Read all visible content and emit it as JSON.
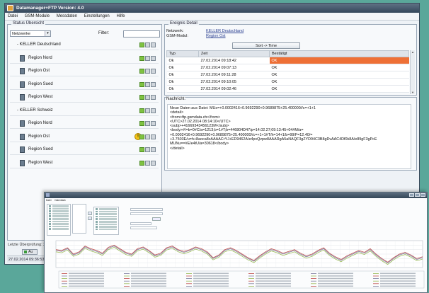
{
  "win1": {
    "title": "Datamanager+FTP Version: 4.0",
    "menu": [
      "Datei",
      "GSM-Module",
      "Messdaten",
      "Einstellungen",
      "Hilfe"
    ],
    "left": {
      "group_title": "Status Übersicht",
      "combo_value": "Netzwerke",
      "filter_label": "Filter:",
      "rows": [
        {
          "label": "- KELLER Deutschland",
          "level": 0,
          "lights": [
            "g",
            "n",
            "n"
          ]
        },
        {
          "label": "Region Nord",
          "level": 1,
          "lights": [
            "g",
            "n",
            "n"
          ]
        },
        {
          "label": "Region Ost",
          "level": 1,
          "lights": [
            "g",
            "n",
            "n"
          ]
        },
        {
          "label": "Region Sued",
          "level": 1,
          "lights": [
            "g",
            "n",
            "n"
          ]
        },
        {
          "label": "Region West",
          "level": 1,
          "lights": [
            "g",
            "n",
            "n"
          ]
        },
        {
          "label": "- KELLER Schweiz",
          "level": 0,
          "lights": [
            "g",
            "n",
            "n"
          ]
        },
        {
          "label": "Region Nord",
          "level": 1,
          "lights": [
            "g",
            "n",
            "n"
          ]
        },
        {
          "label": "Region Ost",
          "level": 1,
          "lights": [
            "g",
            "n",
            "n"
          ],
          "warning": true
        },
        {
          "label": "Region Sued",
          "level": 1,
          "lights": [
            "g",
            "n",
            "n"
          ]
        },
        {
          "label": "Region West",
          "level": 1,
          "lights": [
            "g",
            "n",
            "n"
          ]
        }
      ],
      "last_check": "Letzte Überprüfung: 27.0",
      "datetime": "27.02.2014 09:36:53",
      "au_button": "Au"
    },
    "detail": {
      "group_title": "Ereignis Detail",
      "netzwerk_label": "Netzwerk:",
      "netzwerk_value": "KELLER Deutschland",
      "modul_label": "GSM-Modul:",
      "modul_value": "Region Ost",
      "sort_button": "Sort -> Time",
      "columns": [
        "Typ",
        "Zeit",
        "Bestätigt"
      ],
      "rows": [
        [
          "Ok",
          "27.02.2014 09:18:42",
          "OK"
        ],
        [
          "Ok",
          "27.02.2014 09:07:13",
          "OK"
        ],
        [
          "Ok",
          "27.02.2014 09:11:28",
          "OK"
        ],
        [
          "Ok",
          "27.02.2014 09:10:05",
          "OK"
        ],
        [
          "Ok",
          "27.02.2014 09:02:46",
          "OK"
        ]
      ],
      "note_label": "Nachricht:",
      "note_text": "Neue Daten aus Datei: MUs=+0.0002416+0.9692290+0.9689875+25.400000//c=+1+1\n<detail>\n<from>ftp.gsmdata.ch</from>\n<UTC>27.02.2014 08:14:10</UTC>\n<subj>+41669343456123M</subj>\n<body>#/=b=0#C/a=1213;b=1#T;b=446804D47/p=14.02.27;09:13:45+04#M/a=\n+0.0002416+0.9692290+0.9689875+25.400000//c=+1+1#T/h=14+1/b=99/F=12.40/=\n+3.7503E/u=h+8aoca8cAAAACrYJ+ED9462A/e4pvQzpw8AAARgA5aNAQF3gZYD94C3B8gDvAAC4Df0k8A/e89gF3gPcE\nMUNu==#E/e4tU/a=30618</body>\n</detail>"
    }
  },
  "win2": {
    "menu": [
      "Datei",
      "Datenbank"
    ],
    "chart_data": {
      "type": "line",
      "title": "",
      "xlabel": "",
      "ylabel": "",
      "series": [
        {
          "values": [
            1.2,
            1.18,
            1.24,
            1.1,
            1.15,
            1.28,
            1.22,
            1.18,
            1.12,
            1.25,
            1.3,
            1.22,
            1.14,
            1.1,
            1.22,
            1.26,
            1.18,
            1.08,
            1.12,
            1.24,
            1.28,
            1.2,
            1.16,
            1.2,
            1.26,
            1.22,
            1.15,
            1.02,
            1.08,
            1.2,
            1.24,
            1.18,
            1.1,
            1.02,
            0.96,
            1.06,
            1.15,
            1.22,
            1.18,
            1.12,
            1.16,
            1.2,
            1.12,
            1.06,
            1.1,
            1.18,
            1.24,
            1.12,
            1.04,
            0.98,
            1.06,
            1.12,
            1.18,
            1.14,
            1.22,
            1.1,
            1.0,
            0.92,
            1.02,
            1.1,
            1.14,
            1.08,
            1.0,
            1.04
          ]
        },
        {
          "values": [
            1.18,
            1.16,
            1.22,
            1.08,
            1.13,
            1.26,
            1.2,
            1.16,
            1.1,
            1.23,
            1.28,
            1.2,
            1.12,
            1.08,
            1.2,
            1.24,
            1.16,
            1.06,
            1.1,
            1.22,
            1.26,
            1.18,
            1.14,
            1.18,
            1.24,
            1.2,
            1.13,
            1.0,
            1.06,
            1.18,
            1.22,
            1.16,
            1.08,
            1.0,
            0.94,
            1.04,
            1.13,
            1.2,
            1.16,
            1.1,
            1.14,
            1.18,
            1.1,
            1.04,
            1.08,
            1.16,
            1.22,
            1.1,
            1.02,
            0.96,
            1.04,
            1.1,
            1.16,
            1.12,
            1.2,
            1.08,
            0.98,
            0.9,
            1.0,
            1.08,
            1.12,
            1.06,
            0.98,
            1.02
          ]
        },
        {
          "values": [
            1.15,
            1.13,
            1.19,
            1.05,
            1.1,
            1.23,
            1.17,
            1.13,
            1.07,
            1.2,
            1.25,
            1.17,
            1.09,
            1.05,
            1.17,
            1.21,
            1.13,
            1.03,
            1.07,
            1.19,
            1.23,
            1.15,
            1.11,
            1.15,
            1.21,
            1.17,
            1.1,
            0.97,
            1.03,
            1.15,
            1.19,
            1.13,
            1.05,
            0.97,
            0.91,
            1.01,
            1.1,
            1.17,
            1.13,
            1.07,
            1.11,
            1.15,
            1.07,
            1.01,
            1.05,
            1.13,
            1.19,
            1.07,
            0.99,
            0.93,
            1.01,
            1.07,
            1.13,
            1.09,
            1.17,
            1.05,
            0.95,
            0.87,
            0.97,
            1.05,
            1.09,
            1.03,
            0.95,
            0.99
          ]
        }
      ],
      "colors": [
        "#c0504d",
        "#7f7f9f",
        "#9bbb59"
      ]
    }
  },
  "colors": {
    "background": "#5aa79a",
    "highlight": "#ee7036",
    "status_ok": "#7fc241"
  }
}
